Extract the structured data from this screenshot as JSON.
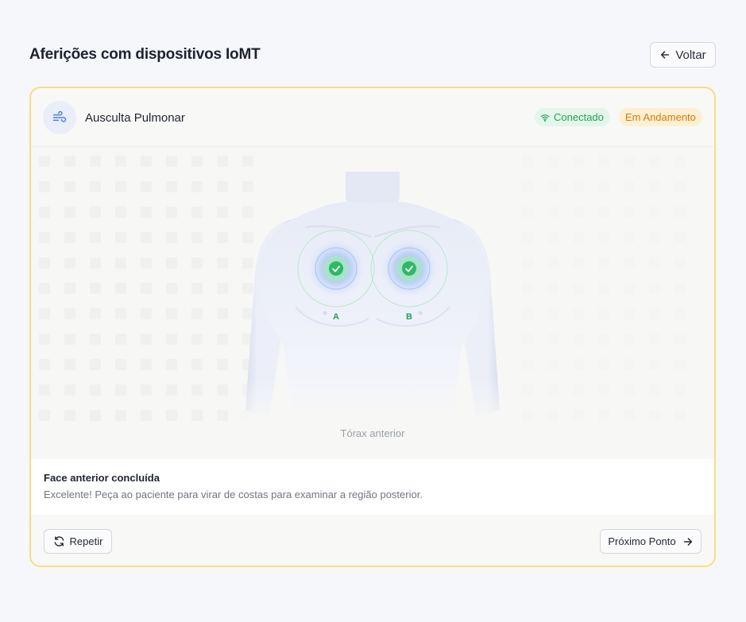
{
  "page": {
    "title": "Aferições com dispositivos IoMT",
    "back_label": "Voltar"
  },
  "card": {
    "title": "Ausculta Pulmonar",
    "icon": "wind-icon",
    "badges": {
      "connected": "Conectado",
      "status": "Em Andamento"
    },
    "view_label": "Tórax anterior",
    "points": [
      {
        "label": "A",
        "status": "completed"
      },
      {
        "label": "B",
        "status": "completed"
      }
    ],
    "status_title": "Face anterior concluída",
    "status_description": "Excelente! Peça ao paciente para virar de costas para examinar a região posterior.",
    "repeat_label": "Repetir",
    "next_label": "Próximo Ponto"
  },
  "colors": {
    "card_border": "#f7dc86",
    "success": "#23a05a",
    "warning": "#d47a0e",
    "pulse_blue": "#6f9ff0"
  }
}
